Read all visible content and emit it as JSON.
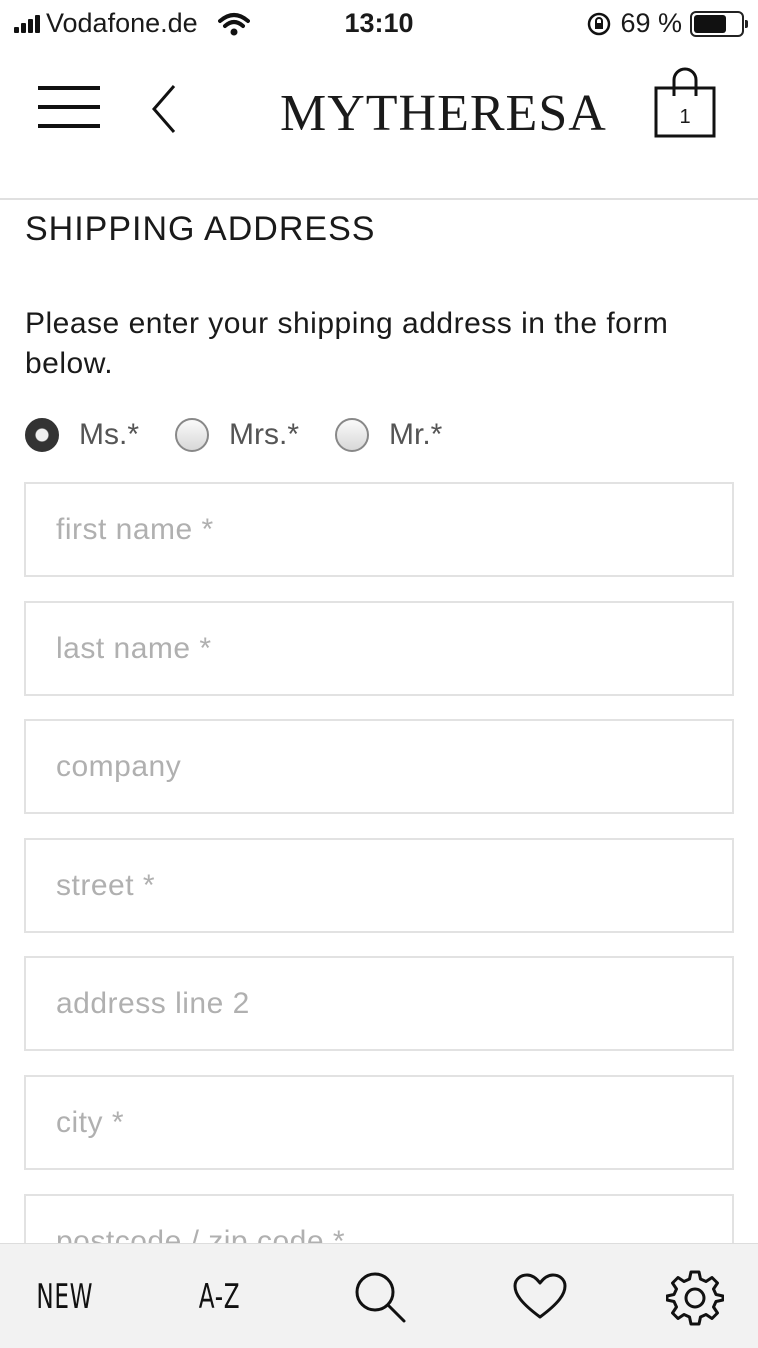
{
  "status_bar": {
    "carrier": "Vodafone.de",
    "time": "13:10",
    "battery": "69 %",
    "battery_level": 0.69
  },
  "header": {
    "brand": "MYTHERESA",
    "cart_count": "1"
  },
  "form": {
    "title": "SHIPPING ADDRESS",
    "intro": "Please enter your shipping address in the form below.",
    "salutations": [
      {
        "label": "Ms.*",
        "selected": true
      },
      {
        "label": "Mrs.*",
        "selected": false
      },
      {
        "label": "Mr.*",
        "selected": false
      }
    ],
    "fields": [
      {
        "placeholder": "first name *",
        "value": ""
      },
      {
        "placeholder": "last name *",
        "value": ""
      },
      {
        "placeholder": "company",
        "value": ""
      },
      {
        "placeholder": "street *",
        "value": ""
      },
      {
        "placeholder": "address line 2",
        "value": ""
      },
      {
        "placeholder": "city *",
        "value": ""
      },
      {
        "placeholder": "postcode / zip code *",
        "value": ""
      }
    ]
  },
  "tabbar": {
    "new_label": "NEW",
    "az_label": "A-Z",
    "icons": [
      "search-icon",
      "heart-icon",
      "gear-icon"
    ]
  }
}
